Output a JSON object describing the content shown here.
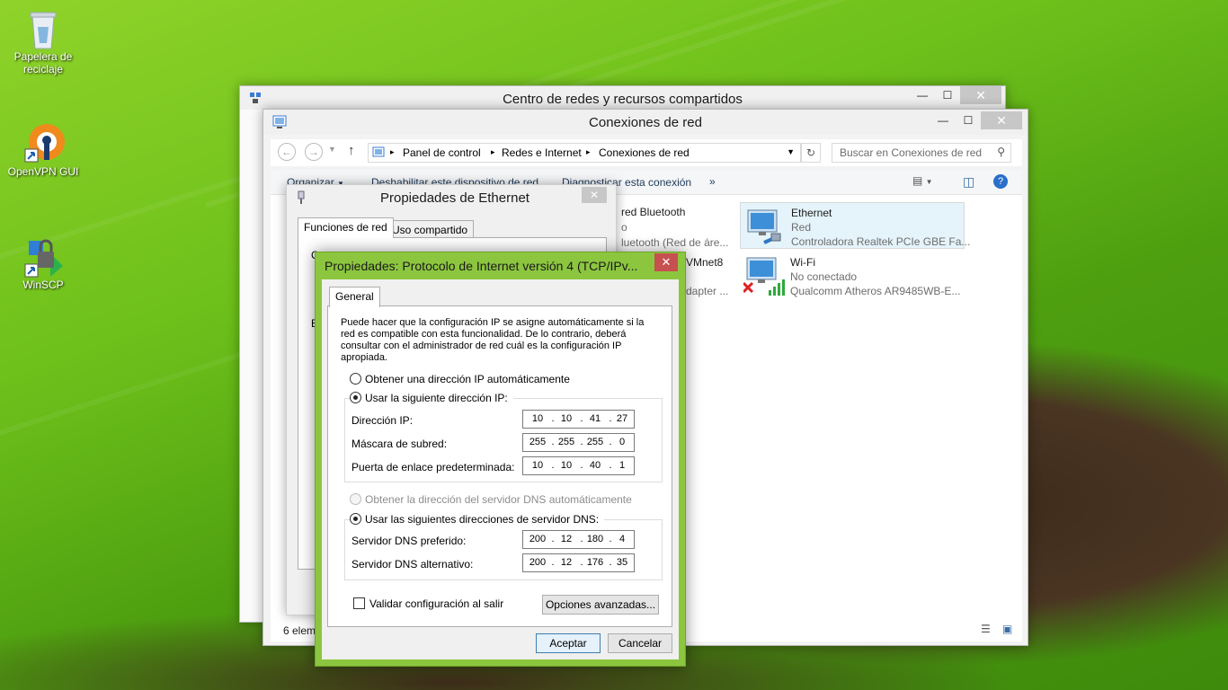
{
  "desktop": {
    "icons": [
      {
        "label": "Papelera de reciclaje"
      },
      {
        "label": "OpenVPN GUI"
      },
      {
        "label": "WinSCP"
      }
    ]
  },
  "window_network_center": {
    "title": "Centro de redes y recursos compartidos"
  },
  "window_connections": {
    "title": "Conexiones de red",
    "breadcrumb": [
      "Panel de control",
      "Redes e Internet",
      "Conexiones de red"
    ],
    "search_placeholder": "Buscar en Conexiones de red",
    "toolbar": {
      "organize": "Organizar",
      "disable": "Deshabilitar este dispositivo de red",
      "diagnose": "Diagnosticar esta conexión",
      "more": "»"
    },
    "connections": [
      {
        "name": "red Bluetooth",
        "status": "o",
        "device": "luetooth (Red de áre..."
      },
      {
        "name": "VMnet8",
        "status": "",
        "device": "dapter ..."
      },
      {
        "name": "Ethernet",
        "status": "Red",
        "device": "Controladora Realtek PCIe GBE Fa..."
      },
      {
        "name": "Wi-Fi",
        "status": "No conectado",
        "device": "Qualcomm Atheros AR9485WB-E..."
      }
    ],
    "status_bar": "6 elem"
  },
  "window_ethernet": {
    "title": "Propiedades de Ethernet",
    "tabs": [
      "Funciones de red",
      "Uso compartido"
    ],
    "fragment_c": "C",
    "fragment_e": "E"
  },
  "window_tcp": {
    "title": "Propiedades: Protocolo de Internet versión 4 (TCP/IPv...",
    "tab": "General",
    "description": "Puede hacer que la configuración IP se asigne automáticamente si la red es compatible con esta funcionalidad. De lo contrario, deberá consultar con el administrador de red cuál es la configuración IP apropiada.",
    "desc_lines": [
      "Puede hacer que la configuración IP se asigne automáticamente si la",
      "red es compatible con esta funcionalidad. De lo contrario, deberá",
      "consultar con el administrador de red cuál es la configuración IP",
      "apropiada."
    ],
    "ip_auto_label": "Obtener una dirección IP automáticamente",
    "ip_manual_label": "Usar la siguiente dirección IP:",
    "ip_address_label": "Dirección IP:",
    "ip_address": [
      "10",
      "10",
      "41",
      "27"
    ],
    "subnet_label": "Máscara de subred:",
    "subnet": [
      "255",
      "255",
      "255",
      "0"
    ],
    "gateway_label": "Puerta de enlace predeterminada:",
    "gateway": [
      "10",
      "10",
      "40",
      "1"
    ],
    "dns_auto_label": "Obtener la dirección del servidor DNS automáticamente",
    "dns_manual_label": "Usar las siguientes direcciones de servidor DNS:",
    "dns_pref_label": "Servidor DNS preferido:",
    "dns_pref": [
      "200",
      "12",
      "180",
      "4"
    ],
    "dns_alt_label": "Servidor DNS alternativo:",
    "dns_alt": [
      "200",
      "12",
      "176",
      "35"
    ],
    "validate_label": "Validar configuración al salir",
    "advanced_button": "Opciones avanzadas...",
    "ok_button": "Aceptar",
    "cancel_button": "Cancelar",
    "close_glyph": "✕"
  },
  "colors": {
    "accent": "#8cc63f",
    "close_red": "#c75050"
  }
}
